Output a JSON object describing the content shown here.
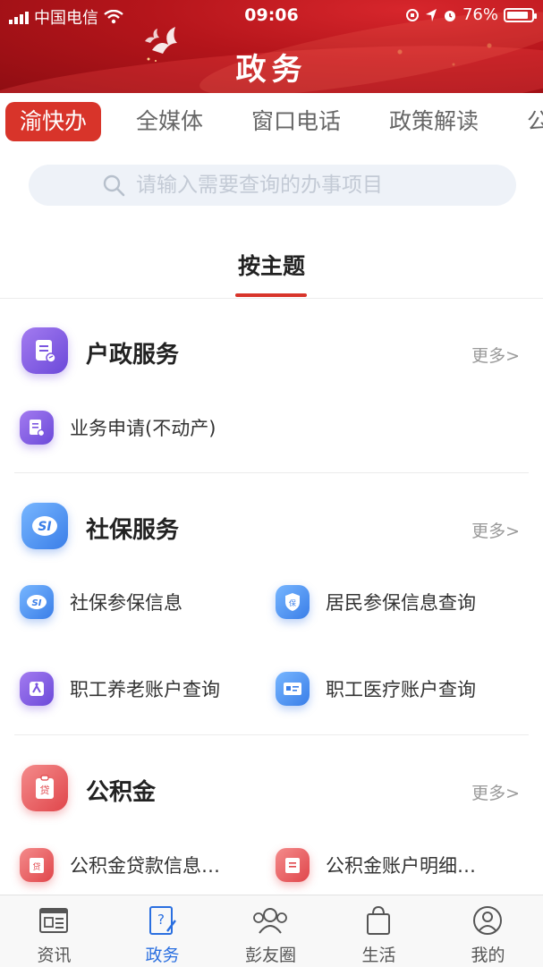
{
  "status_bar": {
    "carrier": "中国电信",
    "time": "09:06",
    "battery": "76%"
  },
  "header": {
    "title": "政务"
  },
  "tabs": [
    {
      "label": "渝快办",
      "active": true
    },
    {
      "label": "全媒体",
      "active": false
    },
    {
      "label": "窗口电话",
      "active": false
    },
    {
      "label": "政策解读",
      "active": false
    },
    {
      "label": "公",
      "active": false
    }
  ],
  "search": {
    "placeholder": "请输入需要查询的办事项目"
  },
  "theme": {
    "label": "按主题"
  },
  "sections": [
    {
      "title": "户政服务",
      "more": "更多>",
      "items": [
        {
          "label": "业务申请(不动产)"
        }
      ]
    },
    {
      "title": "社保服务",
      "more": "更多>",
      "items": [
        {
          "label": "社保参保信息"
        },
        {
          "label": "居民参保信息查询"
        },
        {
          "label": "职工养老账户查询"
        },
        {
          "label": "职工医疗账户查询"
        }
      ]
    },
    {
      "title": "公积金",
      "more": "更多>",
      "items": [
        {
          "label": "公积金贷款信息…"
        },
        {
          "label": "公积金账户明细…"
        }
      ]
    }
  ],
  "bottom_nav": [
    {
      "label": "资讯",
      "icon": "news-icon",
      "active": false
    },
    {
      "label": "政务",
      "icon": "government-icon",
      "active": true
    },
    {
      "label": "彭友圈",
      "icon": "friends-circle-icon",
      "active": false
    },
    {
      "label": "生活",
      "icon": "shopping-bag-icon",
      "active": false
    },
    {
      "label": "我的",
      "icon": "profile-icon",
      "active": false
    }
  ],
  "colors": {
    "accent": "#d8342a",
    "nav_active": "#2a6fe0"
  }
}
